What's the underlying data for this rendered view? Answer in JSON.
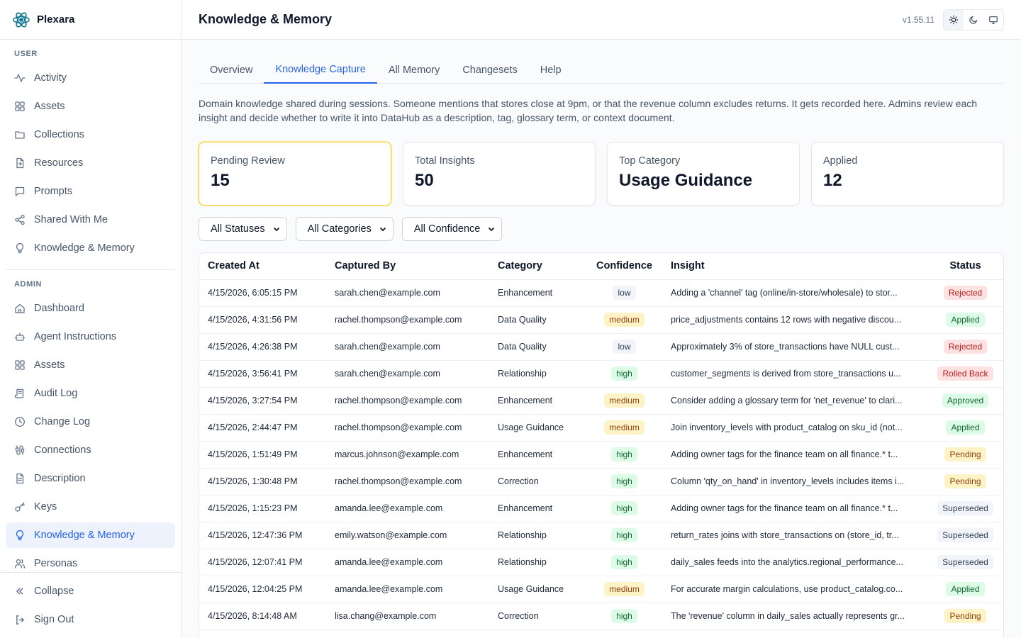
{
  "brand": {
    "name": "Plexara"
  },
  "sidebar": {
    "user_label": "USER",
    "admin_label": "ADMIN",
    "user_items": [
      {
        "label": "Activity",
        "icon": "activity-icon"
      },
      {
        "label": "Assets",
        "icon": "grid-icon"
      },
      {
        "label": "Collections",
        "icon": "folder-icon"
      },
      {
        "label": "Resources",
        "icon": "file-icon"
      },
      {
        "label": "Prompts",
        "icon": "chat-icon"
      },
      {
        "label": "Shared With Me",
        "icon": "share-icon"
      },
      {
        "label": "Knowledge & Memory",
        "icon": "lightbulb-icon"
      }
    ],
    "admin_items": [
      {
        "label": "Dashboard",
        "icon": "home-icon"
      },
      {
        "label": "Agent Instructions",
        "icon": "bot-icon"
      },
      {
        "label": "Assets",
        "icon": "grid-icon"
      },
      {
        "label": "Audit Log",
        "icon": "scroll-icon"
      },
      {
        "label": "Change Log",
        "icon": "clock-icon"
      },
      {
        "label": "Connections",
        "icon": "cable-icon"
      },
      {
        "label": "Description",
        "icon": "file-text-icon"
      },
      {
        "label": "Keys",
        "icon": "key-icon"
      },
      {
        "label": "Knowledge & Memory",
        "icon": "lightbulb-icon",
        "active": true
      },
      {
        "label": "Personas",
        "icon": "users-icon"
      }
    ],
    "collapse_label": "Collapse",
    "signout_label": "Sign Out"
  },
  "header": {
    "title": "Knowledge & Memory",
    "version": "v1.55.11"
  },
  "tabs": [
    {
      "label": "Overview"
    },
    {
      "label": "Knowledge Capture",
      "active": true
    },
    {
      "label": "All Memory"
    },
    {
      "label": "Changesets"
    },
    {
      "label": "Help"
    }
  ],
  "description": "Domain knowledge shared during sessions. Someone mentions that stores close at 9pm, or that the revenue column excludes returns. It gets recorded here. Admins review each insight and decide whether to write it into DataHub as a description, tag, glossary term, or context document.",
  "cards": [
    {
      "label": "Pending Review",
      "value": "15"
    },
    {
      "label": "Total Insights",
      "value": "50"
    },
    {
      "label": "Top Category",
      "value": "Usage Guidance"
    },
    {
      "label": "Applied",
      "value": "12"
    }
  ],
  "filters": {
    "status": "All Statuses",
    "category": "All Categories",
    "confidence": "All Confidence"
  },
  "table": {
    "headers": {
      "created": "Created At",
      "captured": "Captured By",
      "category": "Category",
      "confidence": "Confidence",
      "insight": "Insight",
      "status": "Status"
    },
    "rows": [
      {
        "created": "4/15/2026, 6:05:15 PM",
        "captured": "sarah.chen@example.com",
        "category": "Enhancement",
        "confidence": "low",
        "insight": "Adding a 'channel' tag (online/in-store/wholesale) to stor...",
        "status": "Rejected"
      },
      {
        "created": "4/15/2026, 4:31:56 PM",
        "captured": "rachel.thompson@example.com",
        "category": "Data Quality",
        "confidence": "medium",
        "insight": "price_adjustments contains 12 rows with negative discou...",
        "status": "Applied"
      },
      {
        "created": "4/15/2026, 4:26:38 PM",
        "captured": "sarah.chen@example.com",
        "category": "Data Quality",
        "confidence": "low",
        "insight": "Approximately 3% of store_transactions have NULL cust...",
        "status": "Rejected"
      },
      {
        "created": "4/15/2026, 3:56:41 PM",
        "captured": "sarah.chen@example.com",
        "category": "Relationship",
        "confidence": "high",
        "insight": "customer_segments is derived from store_transactions u...",
        "status": "Rolled Back"
      },
      {
        "created": "4/15/2026, 3:27:54 PM",
        "captured": "rachel.thompson@example.com",
        "category": "Enhancement",
        "confidence": "medium",
        "insight": "Consider adding a glossary term for 'net_revenue' to clari...",
        "status": "Approved"
      },
      {
        "created": "4/15/2026, 2:44:47 PM",
        "captured": "rachel.thompson@example.com",
        "category": "Usage Guidance",
        "confidence": "medium",
        "insight": "Join inventory_levels with product_catalog on sku_id (not...",
        "status": "Applied"
      },
      {
        "created": "4/15/2026, 1:51:49 PM",
        "captured": "marcus.johnson@example.com",
        "category": "Enhancement",
        "confidence": "high",
        "insight": "Adding owner tags for the finance team on all finance.* t...",
        "status": "Pending"
      },
      {
        "created": "4/15/2026, 1:30:48 PM",
        "captured": "rachel.thompson@example.com",
        "category": "Correction",
        "confidence": "high",
        "insight": "Column 'qty_on_hand' in inventory_levels includes items i...",
        "status": "Pending"
      },
      {
        "created": "4/15/2026, 1:15:23 PM",
        "captured": "amanda.lee@example.com",
        "category": "Enhancement",
        "confidence": "high",
        "insight": "Adding owner tags for the finance team on all finance.* t...",
        "status": "Superseded"
      },
      {
        "created": "4/15/2026, 12:47:36 PM",
        "captured": "emily.watson@example.com",
        "category": "Relationship",
        "confidence": "high",
        "insight": "return_rates joins with store_transactions on (store_id, tr...",
        "status": "Superseded"
      },
      {
        "created": "4/15/2026, 12:07:41 PM",
        "captured": "amanda.lee@example.com",
        "category": "Relationship",
        "confidence": "high",
        "insight": "daily_sales feeds into the analytics.regional_performance...",
        "status": "Superseded"
      },
      {
        "created": "4/15/2026, 12:04:25 PM",
        "captured": "amanda.lee@example.com",
        "category": "Usage Guidance",
        "confidence": "medium",
        "insight": "For accurate margin calculations, use product_catalog.co...",
        "status": "Applied"
      },
      {
        "created": "4/15/2026, 8:14:48 AM",
        "captured": "lisa.chang@example.com",
        "category": "Correction",
        "confidence": "high",
        "insight": "The 'revenue' column in daily_sales actually represents gr...",
        "status": "Pending"
      }
    ]
  },
  "colors": {
    "accent": "#2563eb",
    "active_bg": "#eef2fc",
    "highlight_border": "#fcd34d"
  }
}
